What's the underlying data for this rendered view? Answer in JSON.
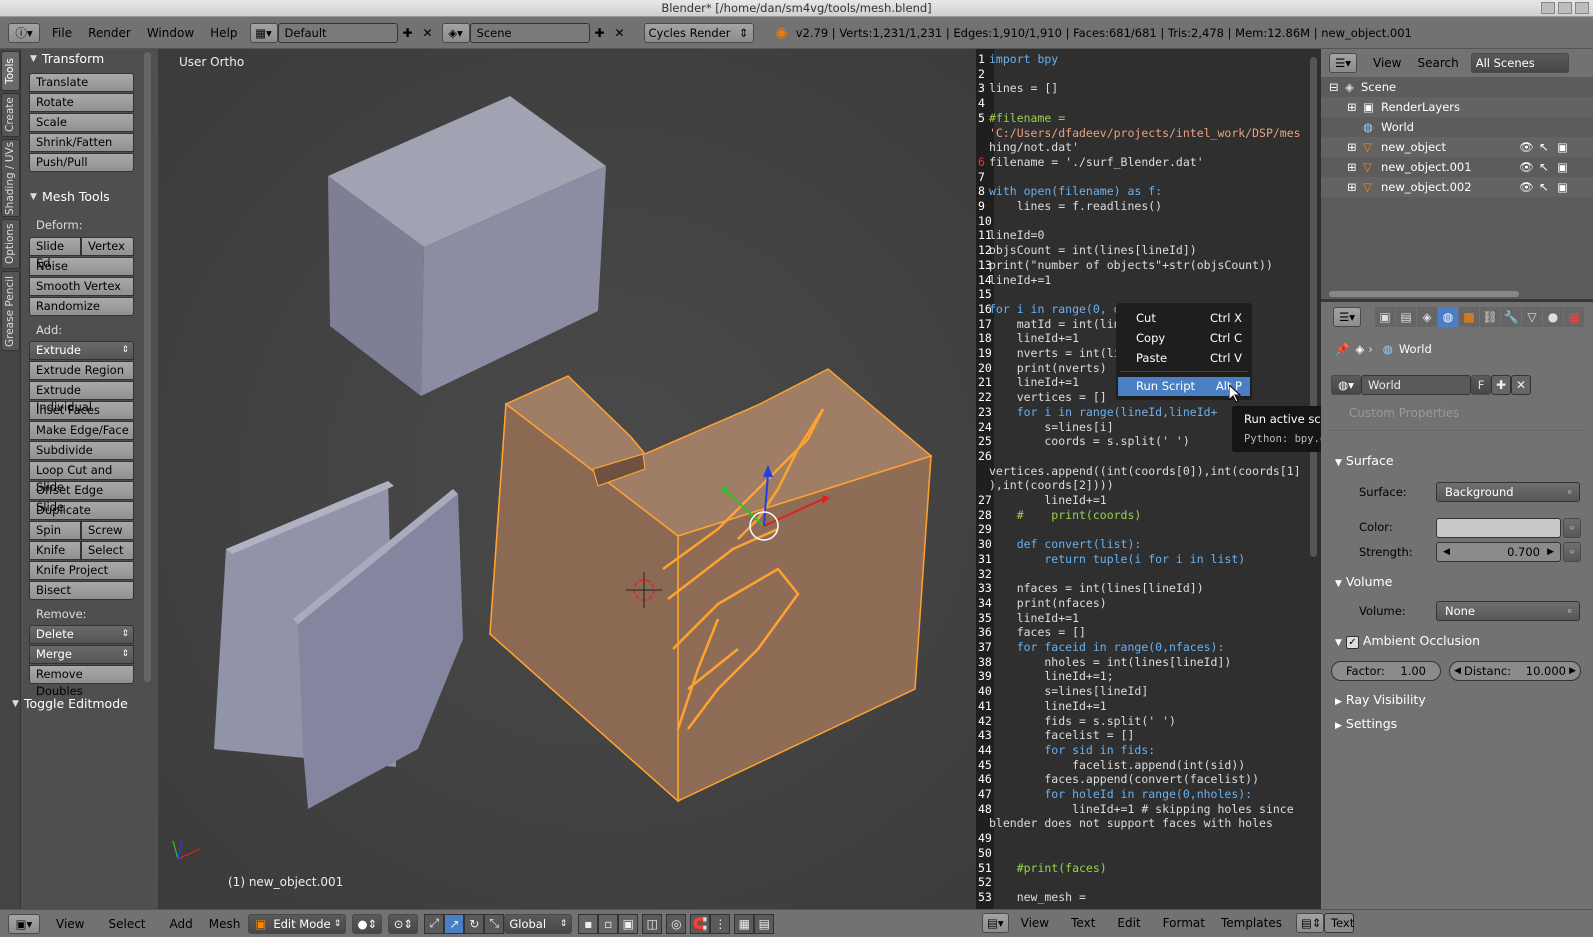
{
  "window": {
    "title": "Blender* [/home/dan/sm4vg/tools/mesh.blend]"
  },
  "topbar": {
    "menus": [
      "File",
      "Render",
      "Window",
      "Help"
    ],
    "layout": "Default",
    "scene": "Scene",
    "engine": "Cycles Render",
    "stats": "v2.79 | Verts:1,231/1,231 | Edges:1,910/1,910 | Faces:681/681 | Tris:2,478 | Mem:12.86M | new_object.001"
  },
  "toolshelf": {
    "tabs": [
      "Tools",
      "Create",
      "Shading / UVs",
      "Options",
      "Grease Pencil"
    ],
    "transform_title": "Transform",
    "transform": [
      "Translate",
      "Rotate",
      "Scale",
      "Shrink/Fatten",
      "Push/Pull"
    ],
    "meshtools_title": "Mesh Tools",
    "deform_label": "Deform:",
    "slide_edge": "Slide Ed",
    "vertex": "Vertex",
    "deform": [
      "Noise",
      "Smooth Vertex",
      "Randomize"
    ],
    "add_label": "Add:",
    "extrude": "Extrude",
    "add": [
      "Extrude Region",
      "Extrude Individual",
      "Inset Faces",
      "Make Edge/Face",
      "Subdivide",
      "Loop Cut and Slide",
      "Offset Edge Slide",
      "Duplicate"
    ],
    "spin": "Spin",
    "screw": "Screw",
    "knife": "Knife",
    "select": "Select",
    "add2": [
      "Knife Project",
      "Bisect"
    ],
    "remove_label": "Remove:",
    "delete": "Delete",
    "merge": "Merge",
    "remove_doubles": "Remove Doubles",
    "toggle_editmode": "Toggle Editmode"
  },
  "viewport": {
    "view_name": "User Ortho",
    "object_label": "(1) new_object.001"
  },
  "texteditor": {
    "lines": [
      {
        "n": "1",
        "t": "import bpy"
      },
      {
        "n": "2",
        "t": ""
      },
      {
        "n": "3",
        "t": "lines = []"
      },
      {
        "n": "4",
        "t": ""
      },
      {
        "n": "5",
        "t": "#filename ="
      },
      {
        "n": "",
        "t": "'C:/Users/dfadeev/projects/intel_work/DSP/mes"
      },
      {
        "n": "",
        "t": "hing/not.dat'"
      },
      {
        "n": "6",
        "t": "filename = './surf_Blender.dat'"
      },
      {
        "n": "7",
        "t": ""
      },
      {
        "n": "8",
        "t": "with open(filename) as f:"
      },
      {
        "n": "9",
        "t": "    lines = f.readlines()"
      },
      {
        "n": "10",
        "t": ""
      },
      {
        "n": "11",
        "t": "lineId=0"
      },
      {
        "n": "12",
        "t": "objsCount = int(lines[lineId])"
      },
      {
        "n": "13",
        "t": "print(\"number of objects\"+str(objsCount))"
      },
      {
        "n": "14",
        "t": "lineId+=1"
      },
      {
        "n": "15",
        "t": ""
      },
      {
        "n": "16",
        "t": "for i in range(0, objsCount):"
      },
      {
        "n": "17",
        "t": "    matId = int(lines[lineId])"
      },
      {
        "n": "18",
        "t": "    lineId+=1"
      },
      {
        "n": "19",
        "t": "    nverts = int(lines[lineId])"
      },
      {
        "n": "20",
        "t": "    print(nverts)"
      },
      {
        "n": "21",
        "t": "    lineId+=1"
      },
      {
        "n": "22",
        "t": "    vertices = []"
      },
      {
        "n": "23",
        "t": "    for i in range(lineId,lineId+"
      },
      {
        "n": "24",
        "t": "        s=lines[i]"
      },
      {
        "n": "25",
        "t": "        coords = s.split(' ')"
      },
      {
        "n": "26",
        "t": ""
      },
      {
        "n": "",
        "t": "vertices.append((int(coords[0]),int(coords[1]"
      },
      {
        "n": "",
        "t": "),int(coords[2])))"
      },
      {
        "n": "27",
        "t": "        lineId+=1"
      },
      {
        "n": "28",
        "t": "    #    print(coords)"
      },
      {
        "n": "29",
        "t": ""
      },
      {
        "n": "30",
        "t": "    def convert(list):"
      },
      {
        "n": "31",
        "t": "        return tuple(i for i in list)"
      },
      {
        "n": "32",
        "t": ""
      },
      {
        "n": "33",
        "t": "    nfaces = int(lines[lineId])"
      },
      {
        "n": "34",
        "t": "    print(nfaces)"
      },
      {
        "n": "35",
        "t": "    lineId+=1"
      },
      {
        "n": "36",
        "t": "    faces = []"
      },
      {
        "n": "37",
        "t": "    for faceid in range(0,nfaces):"
      },
      {
        "n": "38",
        "t": "        nholes = int(lines[lineId])"
      },
      {
        "n": "39",
        "t": "        lineId+=1;"
      },
      {
        "n": "40",
        "t": "        s=lines[lineId]"
      },
      {
        "n": "41",
        "t": "        lineId+=1"
      },
      {
        "n": "42",
        "t": "        fids = s.split(' ')"
      },
      {
        "n": "43",
        "t": "        facelist = []"
      },
      {
        "n": "44",
        "t": "        for sid in fids:"
      },
      {
        "n": "45",
        "t": "            facelist.append(int(sid))"
      },
      {
        "n": "46",
        "t": "        faces.append(convert(facelist))"
      },
      {
        "n": "47",
        "t": "        for holeId in range(0,nholes):"
      },
      {
        "n": "48",
        "t": "            lineId+=1 # skipping holes since"
      },
      {
        "n": "",
        "t": "blender does not support faces with holes"
      },
      {
        "n": "49",
        "t": ""
      },
      {
        "n": "50",
        "t": ""
      },
      {
        "n": "51",
        "t": "    #print(faces)"
      },
      {
        "n": "52",
        "t": ""
      },
      {
        "n": "53",
        "t": "    new_mesh ="
      }
    ],
    "context_menu": [
      {
        "label": "Cut",
        "shortcut": "Ctrl X"
      },
      {
        "label": "Copy",
        "shortcut": "Ctrl C"
      },
      {
        "label": "Paste",
        "shortcut": "Ctrl V"
      },
      {
        "label": "Run Script",
        "shortcut": "Alt P"
      }
    ],
    "tooltip_title": "Run active script.",
    "tooltip_python": "Python: bpy.ops.text.run_script()"
  },
  "outliner": {
    "view": "View",
    "search": "Search",
    "filter": "All Scenes",
    "items": [
      "Scene",
      "RenderLayers",
      "World",
      "new_object",
      "new_object.001",
      "new_object.002"
    ]
  },
  "properties": {
    "context": "World",
    "world_name": "World",
    "fake_user": "F",
    "custom_properties": "Custom Properties",
    "surface_title": "Surface",
    "surface_label": "Surface:",
    "surface_value": "Background",
    "color_label": "Color:",
    "strength_label": "Strength:",
    "strength_value": "0.700",
    "volume_title": "Volume",
    "volume_label": "Volume:",
    "volume_value": "None",
    "ao_title": "Ambient Occlusion",
    "factor": "Factor:",
    "factor_value": "1.00",
    "distance": "Distanc:",
    "distance_value": "10.000",
    "ray_visibility": "Ray Visibility",
    "settings": "Settings"
  },
  "bottombar": {
    "view_menus": [
      "View",
      "Select",
      "Add",
      "Mesh"
    ],
    "mode": "Edit Mode",
    "orientation": "Global",
    "text_menus": [
      "View",
      "Text",
      "Edit",
      "Format",
      "Templates"
    ],
    "text_label": "Text"
  }
}
